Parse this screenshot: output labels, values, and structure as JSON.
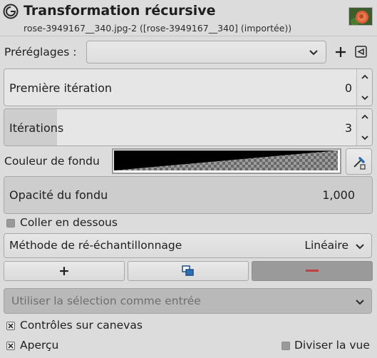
{
  "header": {
    "title": "Transformation récursive",
    "subtitle": "rose-3949167__340.jpg-2 ([rose-3949167__340] (importée))"
  },
  "presets": {
    "label": "Préréglages :",
    "value": ""
  },
  "fields": {
    "first_iteration": {
      "label": "Première itération",
      "value": "0",
      "fill_fraction": 0.0
    },
    "iterations": {
      "label": "Itérations",
      "value": "3",
      "fill_fraction": 0.15
    },
    "fade_color": {
      "label": "Couleur de fondu"
    },
    "fade_opacity": {
      "label": "Opacité du fondu",
      "value": "1,000",
      "fill_fraction": 1.0
    }
  },
  "paste_below": {
    "label": "Coller en dessous",
    "checked": false
  },
  "resampling": {
    "label": "Méthode de ré-échantillonnage",
    "value": "Linéaire"
  },
  "actions": {
    "add": "+"
  },
  "input_selection": {
    "label": "Utiliser la sélection comme entrée"
  },
  "canvas_controls": {
    "label": "Contrôles sur canevas",
    "checked": true
  },
  "preview": {
    "label": "Aperçu",
    "checked": true
  },
  "split_view": {
    "label": "Diviser la vue",
    "checked": false
  },
  "colors": {
    "background": "#dcdcdc",
    "slider_fill": "#cdcdcd",
    "disabled": "#b9b9b9",
    "remove_accent": "#c04040"
  }
}
